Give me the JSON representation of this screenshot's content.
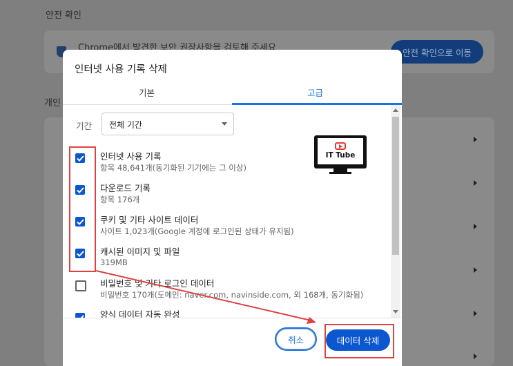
{
  "background": {
    "section_title": "안전 확인",
    "safety_message": "Chrome에서 발견한 보안 권장사항을 검토해 주세요",
    "safety_button": "안전 확인으로 이동",
    "section_title_2": "개인"
  },
  "dialog": {
    "title": "인터넷 사용 기록 삭제",
    "tabs": [
      "기본",
      "고급"
    ],
    "active_tab": "고급",
    "period_label": "기간",
    "period_value": "전체 기간",
    "items": [
      {
        "title": "인터넷 사용 기록",
        "desc": "항목 48,641개(동기화된 기기에는 그 이상)",
        "checked": true
      },
      {
        "title": "다운로드 기록",
        "desc": "항목 176개",
        "checked": true
      },
      {
        "title": "쿠키 및 기타 사이트 데이터",
        "desc": "사이트 1,023개(Google 계정에 로그인된 상태가 유지됨)",
        "checked": true
      },
      {
        "title": "캐시된 이미지 및 파일",
        "desc": "319MB",
        "checked": true
      },
      {
        "title": "비밀번호 및 기타 로그인 데이터",
        "desc": "비밀번호 170개(도메인: naver.com, navinside.com, 외 168개, 동기화됨)",
        "checked": false
      },
      {
        "title": "양식 데이터 자동 완성",
        "desc": "",
        "checked": true
      }
    ],
    "cancel_label": "취소",
    "delete_label": "데이터 삭제"
  },
  "watermark": {
    "text": "IT Tube"
  },
  "colors": {
    "accent": "#1a73e8",
    "primary_button": "#0b57d0",
    "annotation": "#e04040"
  }
}
